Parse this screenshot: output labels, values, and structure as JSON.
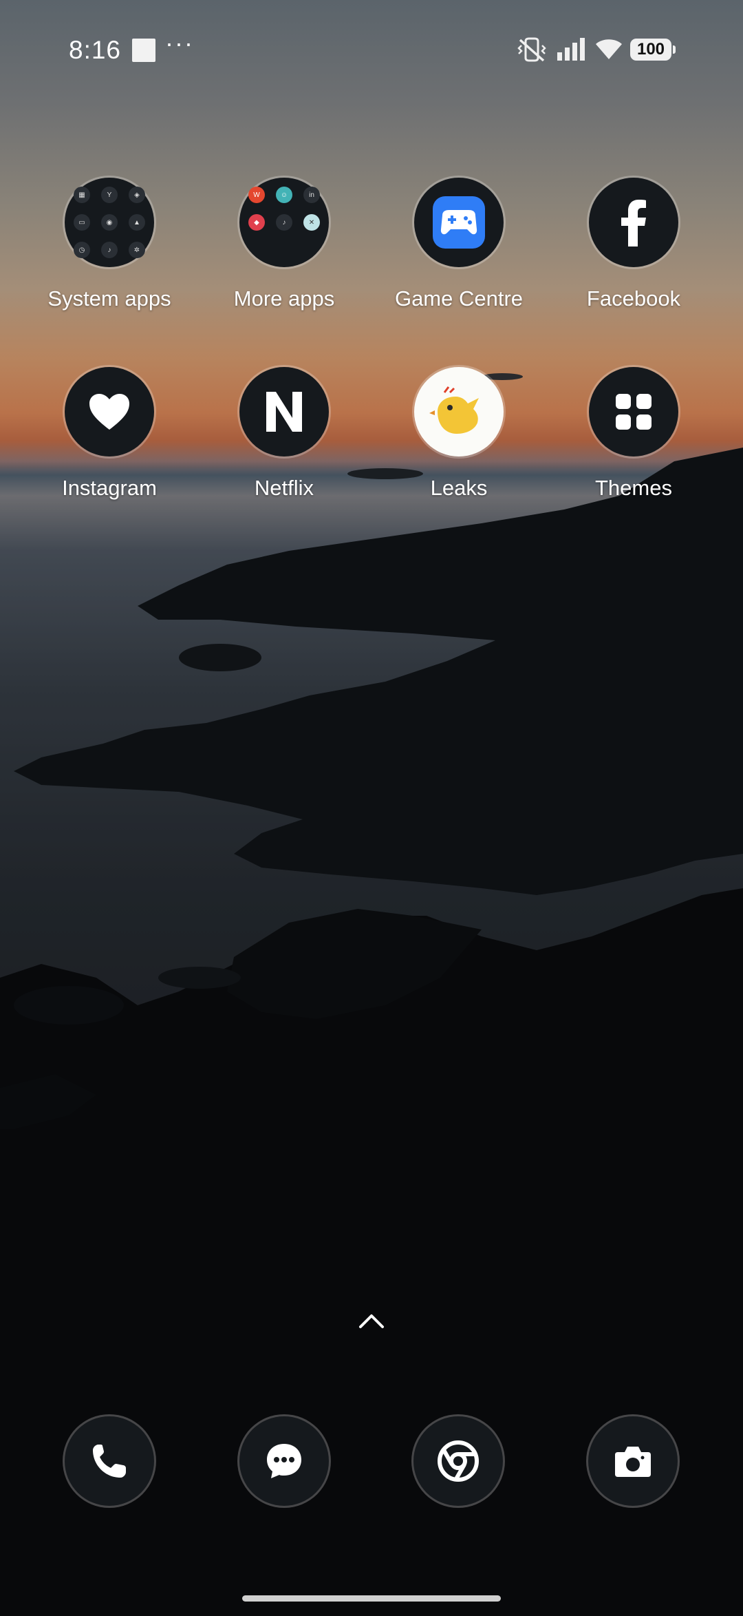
{
  "status_bar": {
    "time": "8:16",
    "more_dots": "···",
    "battery_level": "100",
    "icons": [
      "screenshot-indicator-icon",
      "vibrate-off-icon",
      "signal-icon",
      "wifi-icon",
      "battery-icon"
    ]
  },
  "home": {
    "apps": [
      {
        "label": "System apps",
        "icon": "folder-icon"
      },
      {
        "label": "More apps",
        "icon": "folder-icon"
      },
      {
        "label": "Game Centre",
        "icon": "game-controller-icon"
      },
      {
        "label": "Facebook",
        "icon": "facebook-icon"
      },
      {
        "label": "Instagram",
        "icon": "heart-icon"
      },
      {
        "label": "Netflix",
        "icon": "netflix-n-icon"
      },
      {
        "label": "Leaks",
        "icon": "bird-icon"
      },
      {
        "label": "Themes",
        "icon": "grid-icon"
      }
    ]
  },
  "dock": {
    "items": [
      "phone-icon",
      "messages-icon",
      "chrome-icon",
      "camera-icon"
    ]
  },
  "colors": {
    "icon_bg": "#15191d",
    "game_centre_accent": "#2f7df6",
    "leaks_accent": "#f3c536"
  }
}
